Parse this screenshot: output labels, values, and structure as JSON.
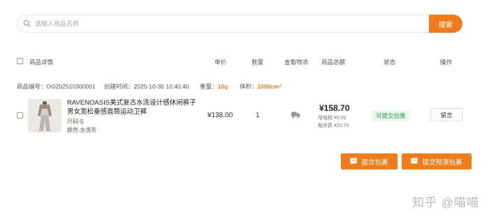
{
  "search": {
    "placeholder": "请输入商品名称",
    "button_label": "搜索",
    "icon": "search-icon"
  },
  "table_header": {
    "product_details": "商品详情",
    "unit_price": "单价",
    "quantity": "数量",
    "view_logistics": "查看物流",
    "total_price": "商品总额",
    "status": "状态",
    "operation": "操作"
  },
  "order": {
    "number_label": "商品编号：",
    "number": "OG202510300001",
    "created_label": "创建时间：",
    "created": "2025-10-30 10:40:40",
    "weight_label": "重量：",
    "weight": "10g",
    "volume_label": "体积：",
    "volume": "1000cm³",
    "product": {
      "title": "RAVENOASIS美式复古水洗设计感休闲裤子男女宽松垂感直筒运动卫裤",
      "size": "尺码:S",
      "color": "颜色:水洗灰"
    },
    "unit_price": "¥138.00",
    "quantity": "1",
    "logistics_icon": "truck-icon",
    "total": "¥158.70",
    "vat_label": "增值税",
    "vat": "¥0.00",
    "service_label": "服务费",
    "service": "¥20.70",
    "status": "可提交包裹",
    "message_button": "留言"
  },
  "actions": {
    "submit_package": "提交包裹",
    "submit_preview_package": "提交预演包裹",
    "icon": "package-icon"
  },
  "watermark": "知乎 @喵喵",
  "colors": {
    "accent": "#f07c1a",
    "status_green": "#2f9e50"
  }
}
